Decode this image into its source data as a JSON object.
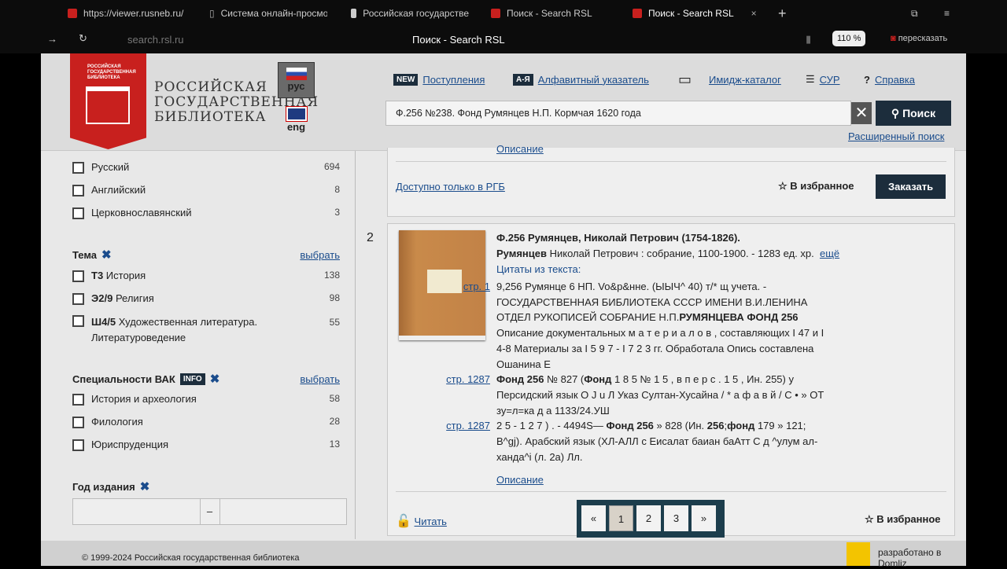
{
  "browser": {
    "tabs": [
      "https://viewer.rusneb.ru/",
      "Система онлайн-просмо",
      "Российская государстве",
      "Поиск - Search RSL",
      "Поиск - Search RSL"
    ],
    "url": "search.rsl.ru",
    "title": "Поиск - Search RSL",
    "zoom": "110 %",
    "retell": "пересказать",
    "close": "×",
    "new_tab": "+"
  },
  "header": {
    "logo_text": "РОССИЙСКАЯ ГОСУДАРСТВЕННАЯ БИБЛИОТЕКА",
    "name_lines": [
      "РОССИЙСКАЯ",
      "ГОСУДАРСТВЕННАЯ",
      "БИБЛИОТЕКА"
    ],
    "lang_ru": "рус",
    "lang_en": "eng",
    "nav": {
      "new_badge": "NEW",
      "new": "Поступления",
      "az_badge": "А-Я",
      "az": "Алфавитный указатель",
      "image": "Имидж-каталог",
      "sur": "СУР",
      "help": "Справка"
    },
    "search_value": "Ф.256 №238. Фонд Румянцев Н.П. Кормчая 1620 года",
    "search_button": "Поиск",
    "advanced": "Расширенный поиск"
  },
  "sidebar": {
    "languages": [
      {
        "label": "Русский",
        "count": "694"
      },
      {
        "label": "Английский",
        "count": "8"
      },
      {
        "label": "Церковнославянский",
        "count": "3"
      }
    ],
    "topic": {
      "title": "Тема",
      "choose": "выбрать",
      "items": [
        {
          "code": "Т3",
          "label": "История",
          "count": "138"
        },
        {
          "code": "Э2/9",
          "label": "Религия",
          "count": "98"
        },
        {
          "code": "Ш4/5",
          "label": "Художественная литература. Литературоведение",
          "count": "55"
        }
      ]
    },
    "vak": {
      "title": "Специальности ВАК",
      "info": "INFO",
      "choose": "выбрать",
      "items": [
        {
          "label": "История и археология",
          "count": "58"
        },
        {
          "label": "Филология",
          "count": "28"
        },
        {
          "label": "Юриспруденция",
          "count": "13"
        }
      ]
    },
    "year": {
      "title": "Год издания",
      "dash": "–"
    }
  },
  "results": {
    "prev_desc": "Описание",
    "prev_access": "Доступно только в РГБ",
    "favorite": "В избранное",
    "order": "Заказать",
    "item": {
      "number": "2",
      "title": "Ф.256 Румянцев, Николай Петрович (1754-1826).",
      "author_bold": "Румянцев",
      "author_rest": " Николай Петрович : собрание, 1100-1900. - 1283 ед. хр.",
      "more": "ещё",
      "quotes_label": "Цитаты из текста:",
      "quotes": [
        {
          "page": "стр. 1",
          "lines": [
            [
              [
                "9,256 Румянце 6 НП. Vo&p&нне. (ЫЫЧ^ 40) т/* щ учета. -",
                0
              ]
            ],
            [
              [
                "ГОСУДАРСТВЕННАЯ БИБЛИОТЕКА СССР ИМЕНИ В.И.ЛЕНИНА",
                0
              ]
            ],
            [
              [
                "ОТДЕЛ РУКОПИСЕЙ СОБРАНИЕ Н.П.",
                0
              ],
              [
                "РУМЯНЦЕВА ФОНД 256",
                1
              ]
            ],
            [
              [
                "Описание документальных м а т е р и а л о в , составляющих I 47 и I",
                0
              ]
            ],
            [
              [
                "4-8 Материалы за I 5 9 7 - I 7 2 3 гг. Обработала Опись составлена",
                0
              ]
            ],
            [
              [
                "Ошанина Е",
                0
              ]
            ]
          ]
        },
        {
          "page": "стр. 1287",
          "lines": [
            [
              [
                "Фонд 256",
                1
              ],
              [
                " № 827 (",
                0
              ],
              [
                "Фонд",
                1
              ],
              [
                " 1 8 5 № 1 5 , в п е р с . 1 5 , Ин. 255) у",
                0
              ]
            ],
            [
              [
                "Персидский язык О J u Л Указ Султан-Хусайна / * а ф а в й / С • » ОТ",
                0
              ]
            ],
            [
              [
                "зу=л=ка д а 1133/24.УШ",
                0
              ]
            ]
          ]
        },
        {
          "page": "стр. 1287",
          "lines": [
            [
              [
                "2 5 - 1 2 7 ) . - 4494S— ",
                0
              ],
              [
                "Фонд 256",
                1
              ],
              [
                " » 828 (Ин. ",
                0
              ],
              [
                "256",
                1
              ],
              [
                ";",
                0
              ],
              [
                "фонд",
                1
              ],
              [
                " 179 » 121;",
                0
              ]
            ],
            [
              [
                "B^gj). Арабский язык (ХЛ-АЛЛ с Еисалат баиан баАтт С д ^улум ал-",
                0
              ]
            ],
            [
              [
                "ханда^i (л. 2а) Лл.",
                0
              ]
            ]
          ]
        }
      ],
      "description": "Описание",
      "read": "Читать",
      "favorite": "В избранное"
    },
    "pager": [
      "«",
      "1",
      "2",
      "3",
      "»"
    ]
  },
  "footer": {
    "copyright": "© 1999-2024 Российская государственная библиотека",
    "dev": "разработано в",
    "dev2": "Domliz"
  }
}
